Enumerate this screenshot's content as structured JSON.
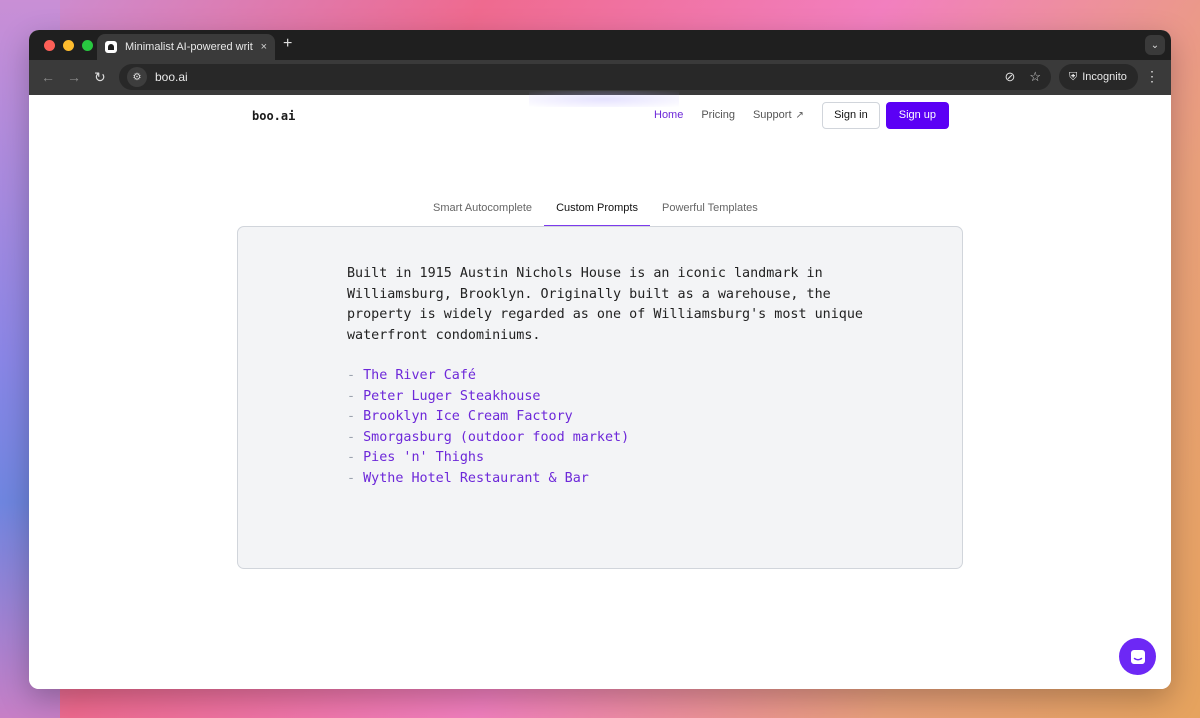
{
  "browser": {
    "tab_title": "Minimalist AI-powered writing",
    "tab_close": "×",
    "new_tab": "+",
    "url": "boo.ai",
    "incognito_label": "Incognito",
    "back": "←",
    "forward": "→",
    "reload": "↻",
    "menu": "⋮",
    "dropdown": "⌄",
    "site_icon": "⚙",
    "eye_off": "⊘",
    "star": "☆",
    "incognito_icon": "⛨"
  },
  "site": {
    "brand": "boo.ai",
    "nav": {
      "home": "Home",
      "pricing": "Pricing",
      "support": "Support",
      "support_ext": "↗",
      "sign_in": "Sign in",
      "sign_up": "Sign up"
    },
    "tabs": [
      "Smart Autocomplete",
      "Custom Prompts",
      "Powerful Templates"
    ],
    "active_tab": "Custom Prompts",
    "paragraph": "Built in 1915 Austin Nichols House is an iconic landmark in Williamsburg, Brooklyn. Originally built as a warehouse, the property is widely regarded as one of Williamsburg's most unique waterfront condominiums.",
    "list_dash": "-",
    "list": [
      "The River Café",
      "Peter Luger Steakhouse",
      "Brooklyn Ice Cream Factory",
      "Smorgasburg (outdoor food market)",
      "Pies 'n' Thighs",
      "Wythe Hotel Restaurant & Bar"
    ]
  },
  "colors": {
    "accent": "#5b00f5",
    "link_active": "#6d28d9",
    "traffic_red": "#fe5f57",
    "traffic_yellow": "#febc2e",
    "traffic_green": "#28c840"
  }
}
